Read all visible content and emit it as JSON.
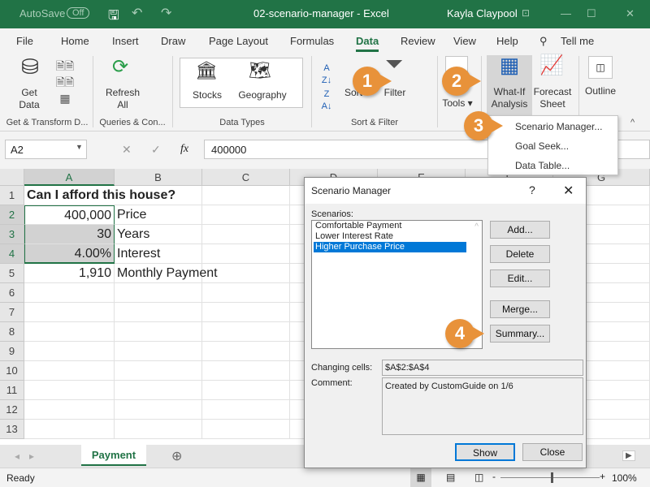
{
  "titlebar": {
    "autosave": "AutoSave",
    "autosave_state": "Off",
    "title": "02-scenario-manager  -  Excel",
    "user": "Kayla Claypool"
  },
  "tabs": [
    "File",
    "Home",
    "Insert",
    "Draw",
    "Page Layout",
    "Formulas",
    "Data",
    "Review",
    "View",
    "Help",
    "Tell me"
  ],
  "active_tab": "Data",
  "ribbon": {
    "get_data": "Get Data",
    "refresh_all": "Refresh All",
    "stocks": "Stocks",
    "geography": "Geography",
    "sort": "Sort",
    "filter": "Filter",
    "tools": "Tools",
    "what_if": "What-If Analysis",
    "forecast": "Forecast Sheet",
    "outline": "Outline",
    "groups": [
      "Get & Transform D...",
      "Queries & Con...",
      "Data Types",
      "Sort & Filter"
    ]
  },
  "whatif_menu": [
    "Scenario Manager...",
    "Goal Seek...",
    "Data Table..."
  ],
  "formula_bar": {
    "name_box": "A2",
    "fx": "fx",
    "value": "400000"
  },
  "columns": [
    "A",
    "B",
    "C",
    "D",
    "E",
    "F",
    "G"
  ],
  "rows": [
    [
      "Can I afford this house?",
      ""
    ],
    [
      "400,000",
      "Price"
    ],
    [
      "30",
      "Years"
    ],
    [
      "4.00%",
      "Interest"
    ],
    [
      "1,910",
      "Monthly Payment"
    ],
    [
      "",
      ""
    ],
    [
      "",
      ""
    ],
    [
      "",
      ""
    ],
    [
      "",
      ""
    ],
    [
      "",
      ""
    ],
    [
      "",
      ""
    ],
    [
      "",
      ""
    ],
    [
      "",
      ""
    ]
  ],
  "sheet_tab": "Payment",
  "status": {
    "ready": "Ready",
    "zoom": "100%"
  },
  "dialog": {
    "title": "Scenario Manager",
    "help": "?",
    "scenarios_label": "Scenarios:",
    "scenarios": [
      "Comfortable Payment",
      "Lower Interest Rate",
      "Higher Purchase Price"
    ],
    "selected": "Higher Purchase Price",
    "buttons": {
      "add": "Add...",
      "delete": "Delete",
      "edit": "Edit...",
      "merge": "Merge...",
      "summary": "Summary...",
      "show": "Show",
      "close": "Close"
    },
    "changing_cells_label": "Changing cells:",
    "changing_cells": "$A$2:$A$4",
    "comment_label": "Comment:",
    "comment": "Created by CustomGuide on 1/6"
  },
  "callouts": [
    "1",
    "2",
    "3",
    "4"
  ],
  "colors": {
    "excel_green": "#217346",
    "callout": "#e8923a",
    "selection": "#0078d7"
  }
}
